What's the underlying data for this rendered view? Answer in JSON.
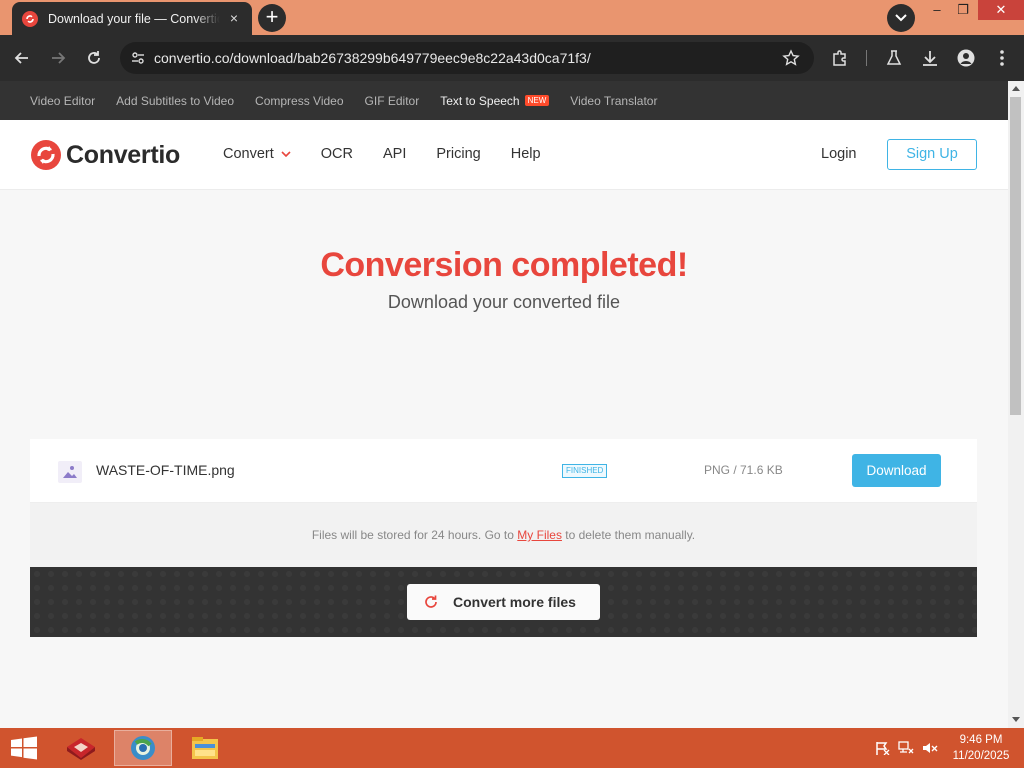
{
  "browser": {
    "tab": {
      "title": "Download your file — Convertio",
      "favicon": "convertio-favicon-icon",
      "close_icon": "×"
    },
    "new_tab_icon": "+",
    "url": "convertio.co/download/bab26738299b649779eec9e8c22a43d0ca71f3/",
    "window_controls": {
      "minimize": "–",
      "maximize": "❐",
      "close": "✕"
    }
  },
  "subnav": {
    "items": [
      {
        "label": "Video Editor"
      },
      {
        "label": "Add Subtitles to Video"
      },
      {
        "label": "Compress Video"
      },
      {
        "label": "GIF Editor"
      },
      {
        "label": "Text to Speech",
        "badge": "NEW"
      },
      {
        "label": "Video Translator"
      }
    ]
  },
  "header": {
    "logo_text": "Convertio",
    "nav": [
      {
        "label": "Convert"
      },
      {
        "label": "OCR"
      },
      {
        "label": "API"
      },
      {
        "label": "Pricing"
      },
      {
        "label": "Help"
      }
    ],
    "login": "Login",
    "signup": "Sign Up"
  },
  "hero": {
    "title": "Conversion completed!",
    "subtitle": "Download your converted file"
  },
  "file": {
    "name": "WASTE-OF-TIME.png",
    "status": "FINISHED",
    "meta": "PNG / 71.6 KB",
    "download_label": "Download"
  },
  "storage_note": {
    "before": "Files will be stored for 24 hours. Go to ",
    "link": "My Files",
    "after": " to delete them manually."
  },
  "convert_more_label": "Convert more files",
  "taskbar": {
    "time": "9:46 PM",
    "date": "11/20/2025"
  },
  "colors": {
    "brand_red": "#e8463d",
    "accent_blue": "#3fb4e5",
    "tabstrip": "#e9956f",
    "taskbar": "#d0542e"
  }
}
